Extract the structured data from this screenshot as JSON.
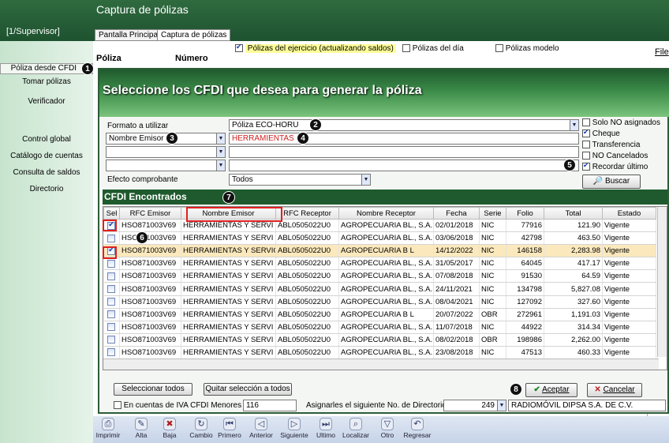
{
  "app": {
    "title": "Captura de pólizas",
    "user": "[1/Supervisor]",
    "tabs": [
      "Pantalla Principal",
      "Captura de pólizas"
    ]
  },
  "sidebar": {
    "items": [
      "Póliza desde CFDI",
      "Tomar pólizas",
      "Verificador",
      "Control global",
      "Catálogo de cuentas",
      "Consulta de saldos",
      "Directorio"
    ]
  },
  "background_form": {
    "chk_ejercicio": "Pólizas del ejercicio (actualizando saldos)",
    "chk_dia": "Pólizas del día",
    "chk_modelo": "Pólizas modelo",
    "poliza_label": "Póliza",
    "numero_label": "Número",
    "file_menu": "File"
  },
  "dialog": {
    "title": "Seleccione los CFDI que desea para generar la póliza",
    "formato_label": "Formato a utilizar",
    "formato_value": "Póliza ECO-HORU",
    "filter1_field": "Nombre Emisor",
    "filter1_value": "HERRAMIENTAS",
    "efecto_label": "Efecto comprobante",
    "efecto_value": "Todos",
    "options": [
      {
        "label": "Solo NO asignados",
        "checked": false
      },
      {
        "label": "Cheque",
        "checked": true
      },
      {
        "label": "Transferencia",
        "checked": false
      },
      {
        "label": "NO Cancelados",
        "checked": false
      },
      {
        "label": "Recordar último",
        "checked": true
      }
    ],
    "buscar_label": "Buscar",
    "grid_title": "CFDI Encontrados",
    "columns": [
      "Sel",
      "RFC Emisor",
      "Nombre Emisor",
      "RFC Receptor",
      "Nombre Receptor",
      "Fecha",
      "Serie",
      "Folio",
      "Total",
      "Estado"
    ],
    "rows": [
      {
        "sel": true,
        "rfc_e": "HSO871003V69",
        "nombre_e": "HERRAMIENTAS Y SERVI",
        "rfc_r": "ABL0505022U0",
        "nombre_r": "AGROPECUARIA BL., S.A.",
        "fecha": "02/01/2018",
        "serie": "NIC",
        "folio": "77916",
        "total": "121.90",
        "estado": "Vigente",
        "hl": false
      },
      {
        "sel": false,
        "rfc_e": "HSO871003V69",
        "nombre_e": "HERRAMIENTAS Y SERVI",
        "rfc_r": "ABL0505022U0",
        "nombre_r": "AGROPECUARIA BL., S.A.",
        "fecha": "03/06/2018",
        "serie": "NIC",
        "folio": "42798",
        "total": "463.50",
        "estado": "Vigente",
        "hl": false
      },
      {
        "sel": true,
        "rfc_e": "HSO871003V69",
        "nombre_e": "HERRAMIENTAS Y SERVICI",
        "rfc_r": "ABL0505022U0",
        "nombre_r": "AGROPECUARIA B L",
        "fecha": "14/12/2022",
        "serie": "NIC",
        "folio": "146158",
        "total": "2,283.98",
        "estado": "Vigente",
        "hl": true
      },
      {
        "sel": false,
        "rfc_e": "HSO871003V69",
        "nombre_e": "HERRAMIENTAS Y SERVI",
        "rfc_r": "ABL0505022U0",
        "nombre_r": "AGROPECUARIA BL., S.A.",
        "fecha": "31/05/2017",
        "serie": "NIC",
        "folio": "64045",
        "total": "417.17",
        "estado": "Vigente",
        "hl": false
      },
      {
        "sel": false,
        "rfc_e": "HSO871003V69",
        "nombre_e": "HERRAMIENTAS Y SERVI",
        "rfc_r": "ABL0505022U0",
        "nombre_r": "AGROPECUARIA BL., S.A.",
        "fecha": "07/08/2018",
        "serie": "NIC",
        "folio": "91530",
        "total": "64.59",
        "estado": "Vigente",
        "hl": false
      },
      {
        "sel": false,
        "rfc_e": "HSO871003V69",
        "nombre_e": "HERRAMIENTAS Y SERVI",
        "rfc_r": "ABL0505022U0",
        "nombre_r": "AGROPECUARIA BL., S.A.",
        "fecha": "24/11/2021",
        "serie": "NIC",
        "folio": "134798",
        "total": "5,827.08",
        "estado": "Vigente",
        "hl": false
      },
      {
        "sel": false,
        "rfc_e": "HSO871003V69",
        "nombre_e": "HERRAMIENTAS Y SERVI",
        "rfc_r": "ABL0505022U0",
        "nombre_r": "AGROPECUARIA BL., S.A.",
        "fecha": "08/04/2021",
        "serie": "NIC",
        "folio": "127092",
        "total": "327.60",
        "estado": "Vigente",
        "hl": false
      },
      {
        "sel": false,
        "rfc_e": "HSO871003V69",
        "nombre_e": "HERRAMIENTAS Y SERVI",
        "rfc_r": "ABL0505022U0",
        "nombre_r": "AGROPECUARIA B L",
        "fecha": "20/07/2022",
        "serie": "OBR",
        "folio": "272961",
        "total": "1,191.03",
        "estado": "Vigente",
        "hl": false
      },
      {
        "sel": false,
        "rfc_e": "HSO871003V69",
        "nombre_e": "HERRAMIENTAS Y SERVI",
        "rfc_r": "ABL0505022U0",
        "nombre_r": "AGROPECUARIA BL., S.A.",
        "fecha": "11/07/2018",
        "serie": "NIC",
        "folio": "44922",
        "total": "314.34",
        "estado": "Vigente",
        "hl": false
      },
      {
        "sel": false,
        "rfc_e": "HSO871003V69",
        "nombre_e": "HERRAMIENTAS Y SERVI",
        "rfc_r": "ABL0505022U0",
        "nombre_r": "AGROPECUARIA BL., S.A.",
        "fecha": "08/02/2018",
        "serie": "OBR",
        "folio": "198986",
        "total": "2,262.00",
        "estado": "Vigente",
        "hl": false
      },
      {
        "sel": false,
        "rfc_e": "HSO871003V69",
        "nombre_e": "HERRAMIENTAS Y SERVI",
        "rfc_r": "ABL0505022U0",
        "nombre_r": "AGROPECUARIA BL., S.A.",
        "fecha": "23/08/2018",
        "serie": "NIC",
        "folio": "47513",
        "total": "460.33",
        "estado": "Vigente",
        "hl": false
      }
    ],
    "select_all": "Seleccionar todos",
    "deselect_all": "Quitar selección a todos",
    "aceptar": "Aceptar",
    "cancelar": "Cancelar",
    "iva_label": "En cuentas de IVA CFDI Menores a:",
    "iva_value": "116",
    "asignar_label": "Asignarles el siguiente No. de Directorio",
    "dir_number": "249",
    "dir_name": "RADIOMÓVIL DIPSA S.A. DE C.V."
  },
  "toolbar": [
    "Imprimir",
    "Alta",
    "Baja",
    "Cambio",
    "Primero",
    "Anterior",
    "Siguiente",
    "Ultimo",
    "Localizar",
    "Otro",
    "Regresar"
  ],
  "badges": [
    "1",
    "2",
    "3",
    "4",
    "5",
    "6",
    "7",
    "8"
  ]
}
